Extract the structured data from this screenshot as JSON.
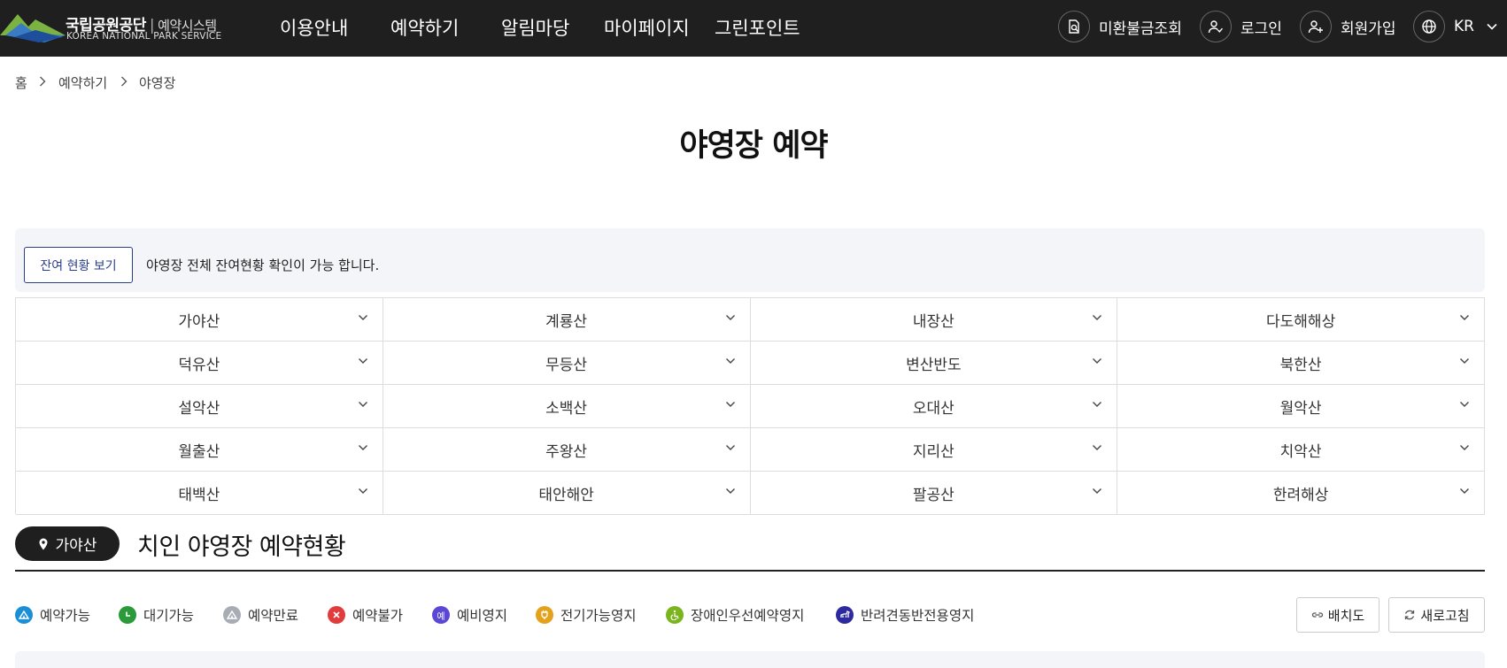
{
  "header": {
    "logo": {
      "title": "국립공원공단",
      "divider": "|",
      "subtitle": "예약시스템",
      "english": "KOREA NATIONAL PARK SERVICE"
    },
    "nav": [
      "이용안내",
      "예약하기",
      "알림마당",
      "마이페이지",
      "그린포인트"
    ],
    "utilities": {
      "refund_lookup": "미환불금조회",
      "login": "로그인",
      "signup": "회원가입",
      "language": "KR"
    }
  },
  "breadcrumb": [
    "홈",
    "예약하기",
    "야영장"
  ],
  "page_title": "야영장 예약",
  "info_box": {
    "button_label": "잔여 현황 보기",
    "text": "야영장 전체 잔여현황 확인이 가능 합니다."
  },
  "mountains": [
    "가야산",
    "계룡산",
    "내장산",
    "다도해해상",
    "덕유산",
    "무등산",
    "변산반도",
    "북한산",
    "설악산",
    "소백산",
    "오대산",
    "월악산",
    "월출산",
    "주왕산",
    "지리산",
    "치악산",
    "태백산",
    "태안해안",
    "팔공산",
    "한려해상"
  ],
  "section": {
    "location": "가야산",
    "title": "치인 야영장 예약현황"
  },
  "legend": [
    {
      "label": "예약가능",
      "icon": "camping-tent-icon",
      "color": "#1a8fd6"
    },
    {
      "label": "대기가능",
      "icon": "clock-icon",
      "color": "#2a9a3a"
    },
    {
      "label": "예약만료",
      "icon": "camping-tent-icon",
      "color": "#a8acb4"
    },
    {
      "label": "예약불가",
      "icon": "close-icon",
      "color": "#e23b3b"
    },
    {
      "label": "예비영지",
      "icon": "reserve-badge-icon",
      "color": "#5a47d6",
      "glyph": "예"
    },
    {
      "label": "전기가능영지",
      "icon": "electric-plug-icon",
      "color": "#e5a11a"
    },
    {
      "label": "장애인우선예약영지",
      "icon": "wheelchair-icon",
      "color": "#7ab51d"
    },
    {
      "label": "반려견동반전용영지",
      "icon": "dog-icon",
      "color": "#2c2a9e"
    }
  ],
  "tools": {
    "layout_map": "배치도",
    "refresh": "새로고침"
  }
}
